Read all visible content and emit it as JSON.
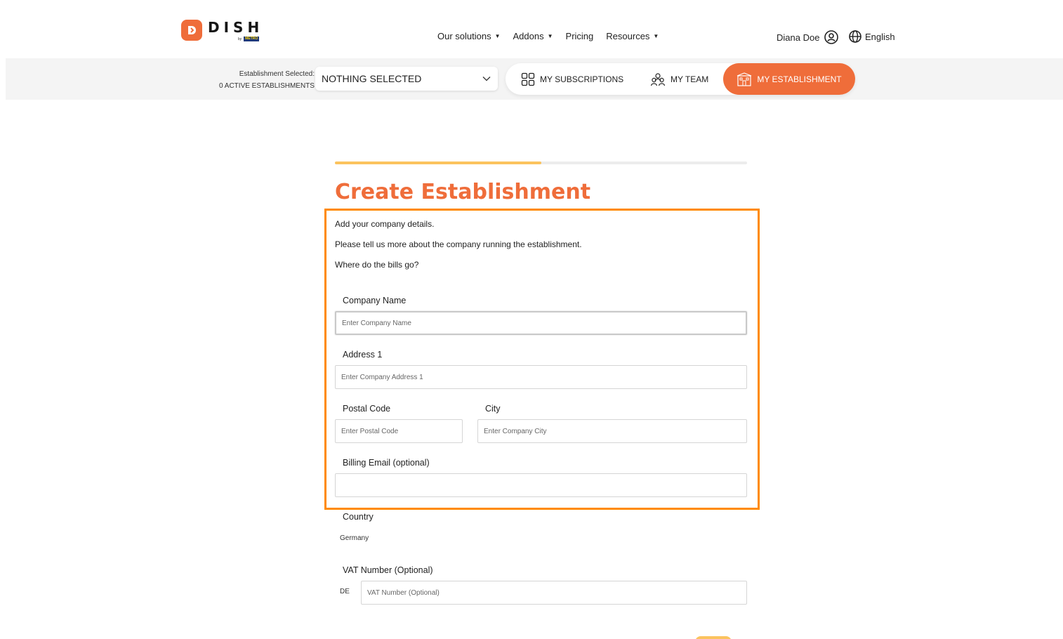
{
  "brand": {
    "name": "DISH",
    "by": "by",
    "metro": "METRO"
  },
  "nav": {
    "items": [
      {
        "label": "Our solutions",
        "dropdown": true
      },
      {
        "label": "Addons",
        "dropdown": true
      },
      {
        "label": "Pricing",
        "dropdown": false
      },
      {
        "label": "Resources",
        "dropdown": true
      }
    ]
  },
  "user": {
    "name": "Diana Doe",
    "language": "English"
  },
  "establishment": {
    "selected_label": "Establishment Selected:",
    "active_count": "0 ACTIVE ESTABLISHMENTS",
    "select_value": "NOTHING SELECTED"
  },
  "tabs": {
    "subscriptions": "MY SUBSCRIPTIONS",
    "team": "MY TEAM",
    "establishment": "MY ESTABLISHMENT"
  },
  "form": {
    "progress_percent": 50,
    "title": "Create Establishment",
    "intro1": "Add your company details.",
    "intro2": "Please tell us more about the company running the establishment.",
    "intro3": "Where do the bills go?",
    "company_name": {
      "label": "Company Name",
      "placeholder": "Enter Company Name",
      "value": ""
    },
    "address1": {
      "label": "Address 1",
      "placeholder": "Enter Company Address 1",
      "value": ""
    },
    "postal_code": {
      "label": "Postal Code",
      "placeholder": "Enter Postal Code",
      "value": ""
    },
    "city": {
      "label": "City",
      "placeholder": "Enter Company City",
      "value": ""
    },
    "billing_email": {
      "label": "Billing Email (optional)",
      "placeholder": "",
      "value": ""
    },
    "country": {
      "label": "Country",
      "value": "Germany"
    },
    "vat": {
      "label": "VAT Number (Optional)",
      "prefix": "DE",
      "placeholder": "VAT Number (Optional)",
      "value": ""
    }
  },
  "colors": {
    "accent": "#ef6d3a",
    "progress": "#fbc35e",
    "highlight": "#ff8a00"
  }
}
